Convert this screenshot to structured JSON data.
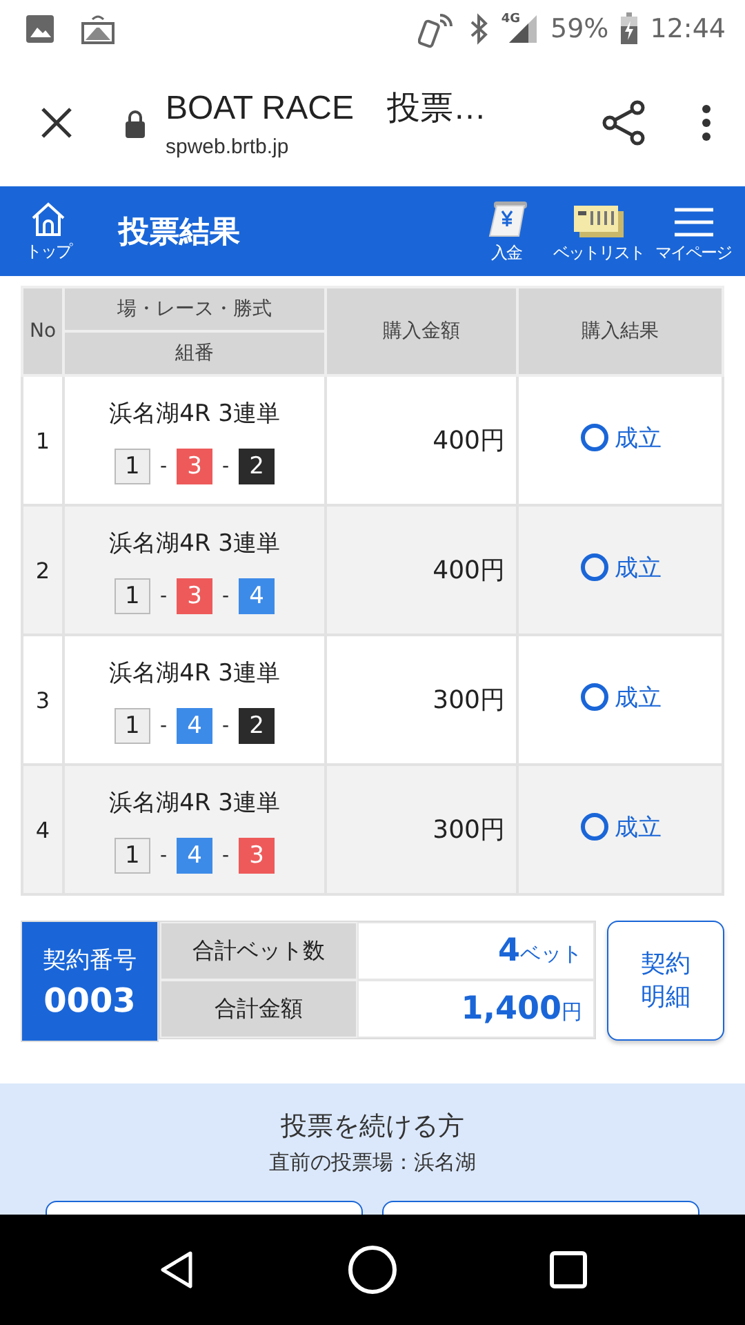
{
  "status_bar": {
    "network": "4G",
    "battery": "59%",
    "time": "12:44"
  },
  "browser": {
    "title": "BOAT RACE　投票…",
    "url": "spweb.brtb.jp"
  },
  "header": {
    "title": "投票結果",
    "home_label": "トップ",
    "actions": [
      {
        "kind": "deposit",
        "label": "入金"
      },
      {
        "kind": "betlist",
        "label": "ベットリスト"
      },
      {
        "kind": "menu",
        "label": "マイページ"
      }
    ]
  },
  "table": {
    "columns": {
      "no": "No",
      "race": "場・レース・勝式",
      "combo": "組番",
      "amount": "購入金額",
      "result": "購入結果"
    },
    "rows": [
      {
        "no": "1",
        "race": "浜名湖4R 3連単",
        "picks": [
          {
            "kind": "boat",
            "text": "1",
            "color": "#eeeeee"
          },
          {
            "kind": "dash",
            "text": "-"
          },
          {
            "kind": "boat",
            "text": "3",
            "color": "#ee5a5a"
          },
          {
            "kind": "dash",
            "text": "-"
          },
          {
            "kind": "boat",
            "text": "2",
            "color": "#2b2b2b"
          }
        ],
        "amount": "400円",
        "result": "成立"
      },
      {
        "no": "2",
        "race": "浜名湖4R 3連単",
        "picks": [
          {
            "kind": "boat",
            "text": "1",
            "color": "#eeeeee"
          },
          {
            "kind": "dash",
            "text": "-"
          },
          {
            "kind": "boat",
            "text": "3",
            "color": "#ee5a5a"
          },
          {
            "kind": "dash",
            "text": "-"
          },
          {
            "kind": "boat",
            "text": "4",
            "color": "#3d8be8"
          }
        ],
        "amount": "400円",
        "result": "成立"
      },
      {
        "no": "3",
        "race": "浜名湖4R 3連単",
        "picks": [
          {
            "kind": "boat",
            "text": "1",
            "color": "#eeeeee"
          },
          {
            "kind": "dash",
            "text": "-"
          },
          {
            "kind": "boat",
            "text": "4",
            "color": "#3d8be8"
          },
          {
            "kind": "dash",
            "text": "-"
          },
          {
            "kind": "boat",
            "text": "2",
            "color": "#2b2b2b"
          }
        ],
        "amount": "300円",
        "result": "成立"
      },
      {
        "no": "4",
        "race": "浜名湖4R 3連単",
        "picks": [
          {
            "kind": "boat",
            "text": "1",
            "color": "#eeeeee"
          },
          {
            "kind": "dash",
            "text": "-"
          },
          {
            "kind": "boat",
            "text": "4",
            "color": "#3d8be8"
          },
          {
            "kind": "dash",
            "text": "-"
          },
          {
            "kind": "boat",
            "text": "3",
            "color": "#ee5a5a"
          }
        ],
        "amount": "300円",
        "result": "成立"
      }
    ]
  },
  "summary": {
    "contract_label": "契約番号",
    "contract_no": "0003",
    "bets_label": "合計ベット数",
    "bets_value": "4",
    "bets_unit": "ベット",
    "total_label": "合計金額",
    "total_value": "1,400",
    "total_unit": "円",
    "detail_button": "契約明細"
  },
  "continue": {
    "title": "投票を続ける方",
    "subtitle": "直前の投票場：浜名湖"
  }
}
